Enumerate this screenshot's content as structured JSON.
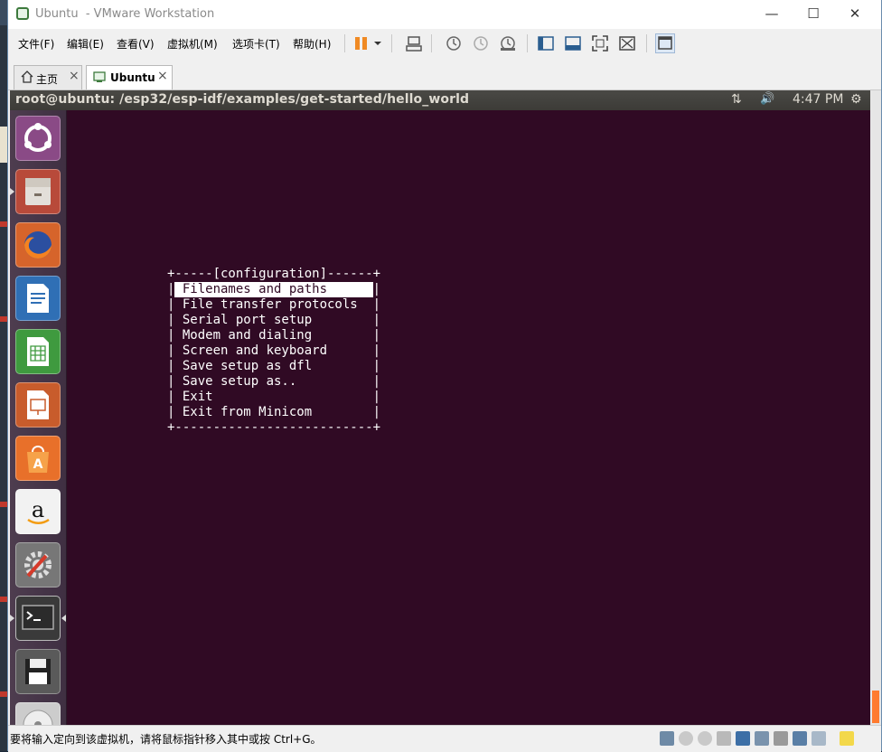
{
  "window": {
    "title": "Ubuntu  - VMware Workstation",
    "minimize": "—",
    "maximize": "☐",
    "close": "✕"
  },
  "menu": [
    {
      "label": "文件(F)"
    },
    {
      "label": "编辑(E)"
    },
    {
      "label": "查看(V)"
    },
    {
      "label": "虚拟机(M)"
    },
    {
      "label": "选项卡(T)"
    },
    {
      "label": "帮助(H)"
    }
  ],
  "tabs": [
    {
      "label": "主页",
      "close": "×"
    },
    {
      "label": "Ubuntu",
      "close": "×"
    }
  ],
  "guest": {
    "topbar_title": "root@ubuntu: /esp32/esp-idf/examples/get-started/hello_world",
    "network_icon": "⇅",
    "volume_icon": "🔊",
    "time": "4:47 PM",
    "settings_icon": "⚙"
  },
  "launcher": [
    {
      "name": "ubuntu-dash-icon"
    },
    {
      "name": "files-icon"
    },
    {
      "name": "firefox-icon"
    },
    {
      "name": "libreoffice-writer-icon"
    },
    {
      "name": "libreoffice-calc-icon"
    },
    {
      "name": "libreoffice-impress-icon"
    },
    {
      "name": "ubuntu-software-icon"
    },
    {
      "name": "amazon-icon"
    },
    {
      "name": "system-settings-icon"
    },
    {
      "name": "terminal-icon"
    },
    {
      "name": "save-disk-icon"
    },
    {
      "name": "dvd-icon"
    }
  ],
  "minicom": {
    "title_line": "+-----[configuration]------+",
    "items": [
      "Filenames and paths",
      "File transfer protocols",
      "Serial port setup",
      "Modem and dialing",
      "Screen and keyboard",
      "Save setup as dfl",
      "Save setup as..",
      "Exit",
      "Exit from Minicom"
    ],
    "selected_index": 0,
    "bottom_line": "+--------------------------+",
    "border_char": "|"
  },
  "status": {
    "message": "要将输入定向到该虚拟机，请将鼠标指针移入其中或按 Ctrl+G。"
  },
  "colors": {
    "terminal_bg": "#300a24",
    "accent_orange": "#ff7b2f"
  }
}
